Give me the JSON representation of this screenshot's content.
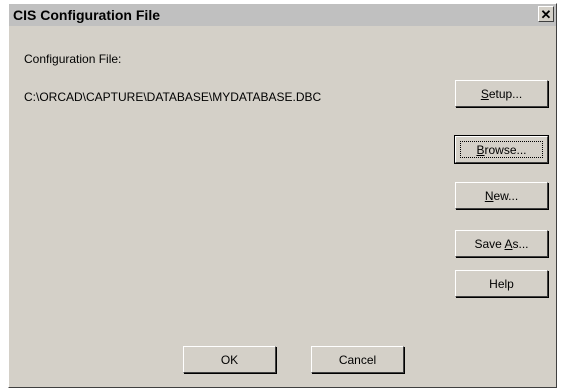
{
  "window": {
    "title": "CIS Configuration File",
    "close_glyph": "✕"
  },
  "content": {
    "config_label": "Configuration File:",
    "config_path": "C:\\ORCAD\\CAPTURE\\DATABASE\\MYDATABASE.DBC"
  },
  "buttons": {
    "setup": {
      "pre": "",
      "key": "S",
      "post": "etup..."
    },
    "browse": {
      "pre": "",
      "key": "B",
      "post": "rowse..."
    },
    "new": {
      "pre": "",
      "key": "N",
      "post": "ew..."
    },
    "save_as": {
      "pre": "Save ",
      "key": "A",
      "post": "s..."
    },
    "help": "Help",
    "ok": "OK",
    "cancel": "Cancel"
  }
}
